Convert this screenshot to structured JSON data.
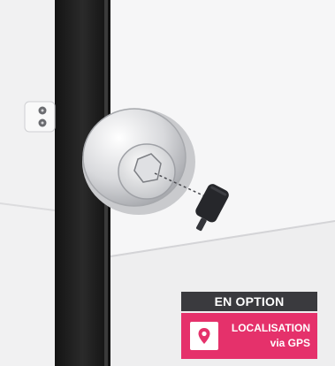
{
  "badge": {
    "header": "EN OPTION",
    "line1": "LOCALISATION",
    "line2": "via GPS",
    "icon": "map-pin-icon",
    "colors": {
      "header_bg": "#3a3a3e",
      "body_bg": "#e5316b",
      "text": "#ffffff"
    }
  },
  "photo": {
    "subject": "lock",
    "objects": [
      "door-handle",
      "lock",
      "key",
      "door-panel"
    ]
  }
}
